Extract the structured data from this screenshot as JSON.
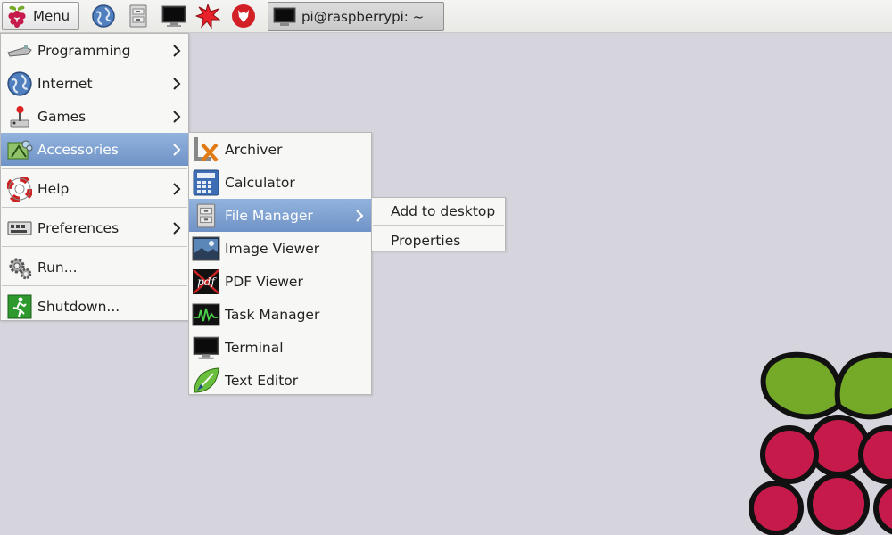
{
  "taskbar": {
    "menu_label": "Menu",
    "launchers": [
      {
        "name": "web-browser-icon"
      },
      {
        "name": "file-manager-icon"
      },
      {
        "name": "terminal-icon"
      },
      {
        "name": "mathematica-icon"
      },
      {
        "name": "wolfram-icon"
      }
    ],
    "task_window_label": "pi@raspberrypi: ~"
  },
  "main_menu": {
    "items": [
      {
        "label": "Programming",
        "icon": "programming-icon",
        "has_submenu": true
      },
      {
        "label": "Internet",
        "icon": "internet-globe-icon",
        "has_submenu": true
      },
      {
        "label": "Games",
        "icon": "joystick-icon",
        "has_submenu": true
      },
      {
        "label": "Accessories",
        "icon": "accessories-icon",
        "has_submenu": true,
        "selected": true
      },
      {
        "label": "Help",
        "icon": "lifebuoy-icon",
        "has_submenu": true
      },
      {
        "label": "Preferences",
        "icon": "preferences-icon",
        "has_submenu": true
      },
      {
        "label": "Run...",
        "icon": "gear-icon",
        "has_submenu": false
      },
      {
        "label": "Shutdown...",
        "icon": "exit-icon",
        "has_submenu": false
      }
    ]
  },
  "accessories_menu": {
    "items": [
      {
        "label": "Archiver",
        "icon": "archiver-icon"
      },
      {
        "label": "Calculator",
        "icon": "calculator-icon"
      },
      {
        "label": "File Manager",
        "icon": "file-manager-icon",
        "selected": true,
        "has_submenu": true
      },
      {
        "label": "Image Viewer",
        "icon": "image-viewer-icon"
      },
      {
        "label": "PDF Viewer",
        "icon": "pdf-icon"
      },
      {
        "label": "Task Manager",
        "icon": "task-manager-icon"
      },
      {
        "label": "Terminal",
        "icon": "terminal-icon"
      },
      {
        "label": "Text Editor",
        "icon": "text-editor-icon"
      }
    ]
  },
  "context_menu": {
    "items": [
      {
        "label": "Add to desktop"
      },
      {
        "label": "Properties"
      }
    ]
  },
  "colors": {
    "desktop": "#d6d5dd",
    "selection": "#7f9fcf",
    "raspberry_red": "#c51a4a",
    "leaf_green": "#75a928"
  }
}
